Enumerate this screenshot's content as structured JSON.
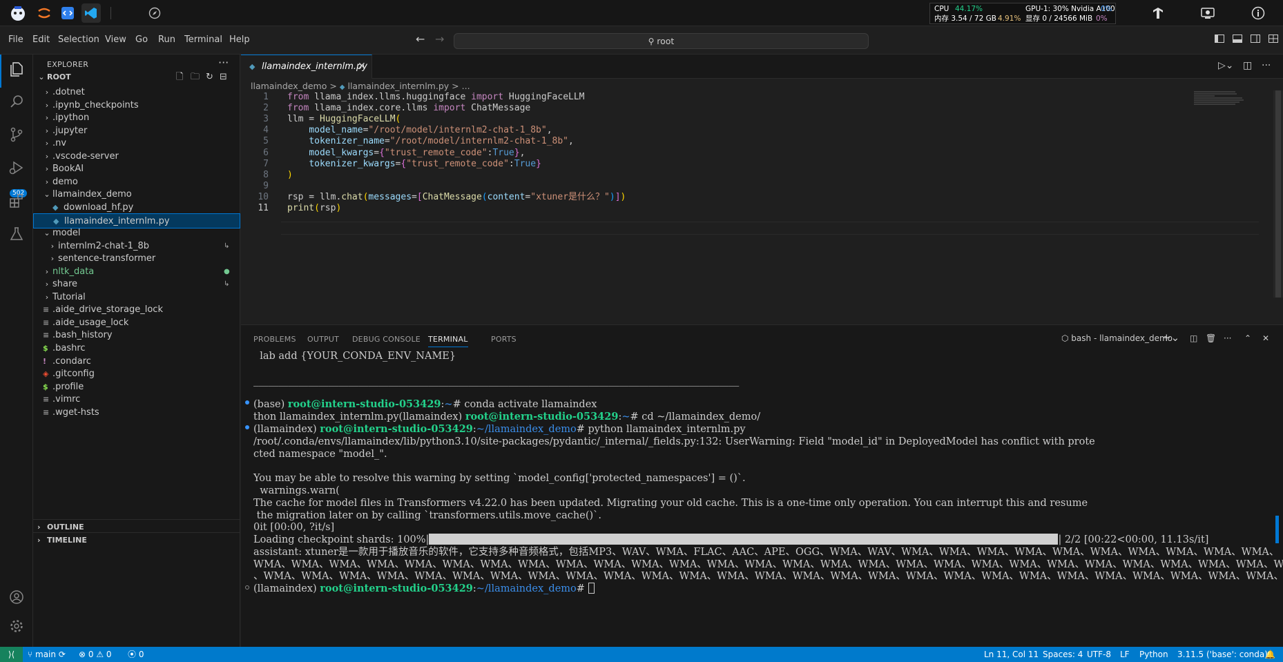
{
  "topbar": {
    "icons": [
      "mascot-icon",
      "jupyter-icon",
      "vscode-blue-icon",
      "vscode-icon",
      "compass-icon"
    ],
    "sys": {
      "cpu_label": "CPU",
      "cpu_val": "44.17%",
      "gpu_label": "GPU-1: 30% Nvidia A100",
      "gpu_val": "0%",
      "mem_label": "内存 3.54 / 72 GB",
      "mem_val": "4.91%",
      "vram_label": "显存 0 / 24566 MiB",
      "vram_val": "0%"
    },
    "right_icons": [
      "tensorboard-icon",
      "remote-desktop-icon",
      "info-icon"
    ]
  },
  "menu": {
    "items": [
      "File",
      "Edit",
      "Selection",
      "View",
      "Go",
      "Run",
      "Terminal",
      "Help"
    ],
    "search": "root"
  },
  "activity": {
    "scm_badge": "502"
  },
  "explorer": {
    "title": "EXPLORER",
    "root": "ROOT",
    "items": [
      {
        "label": ".dotnet",
        "type": "folder",
        "depth": 1,
        "state": "closed"
      },
      {
        "label": ".ipynb_checkpoints",
        "type": "folder",
        "depth": 1,
        "state": "closed"
      },
      {
        "label": ".ipython",
        "type": "folder",
        "depth": 1,
        "state": "closed"
      },
      {
        "label": ".jupyter",
        "type": "folder",
        "depth": 1,
        "state": "closed"
      },
      {
        "label": ".nv",
        "type": "folder",
        "depth": 1,
        "state": "closed"
      },
      {
        "label": ".vscode-server",
        "type": "folder",
        "depth": 1,
        "state": "closed"
      },
      {
        "label": "BookAI",
        "type": "folder",
        "depth": 1,
        "state": "closed"
      },
      {
        "label": "demo",
        "type": "folder",
        "depth": 1,
        "state": "closed"
      },
      {
        "label": "llamaindex_demo",
        "type": "folder",
        "depth": 1,
        "state": "open"
      },
      {
        "label": "download_hf.py",
        "type": "py",
        "depth": 2
      },
      {
        "label": "llamaindex_internlm.py",
        "type": "py",
        "depth": 2,
        "selected": true
      },
      {
        "label": "model",
        "type": "folder",
        "depth": 1,
        "state": "open"
      },
      {
        "label": "internlm2-chat-1_8b",
        "type": "folder",
        "depth": 2,
        "state": "closed",
        "dec": "↳"
      },
      {
        "label": "sentence-transformer",
        "type": "folder",
        "depth": 2,
        "state": "closed"
      },
      {
        "label": "nltk_data",
        "type": "folder",
        "depth": 1,
        "state": "closed",
        "color": "#73c991",
        "dec": "●"
      },
      {
        "label": "share",
        "type": "folder",
        "depth": 1,
        "state": "closed",
        "dec": "↳"
      },
      {
        "label": "Tutorial",
        "type": "folder",
        "depth": 1,
        "state": "closed"
      },
      {
        "label": ".aide_drive_storage_lock",
        "type": "lines",
        "depth": 1
      },
      {
        "label": ".aide_usage_lock",
        "type": "lines",
        "depth": 1
      },
      {
        "label": ".bash_history",
        "type": "lines",
        "depth": 1
      },
      {
        "label": ".bashrc",
        "type": "dollar",
        "depth": 1
      },
      {
        "label": ".condarc",
        "type": "excl",
        "depth": 1
      },
      {
        "label": ".gitconfig",
        "type": "git",
        "depth": 1
      },
      {
        "label": ".profile",
        "type": "dollar",
        "depth": 1
      },
      {
        "label": ".vimrc",
        "type": "lines",
        "depth": 1
      },
      {
        "label": ".wget-hsts",
        "type": "lines",
        "depth": 1
      }
    ],
    "outline": "OUTLINE",
    "timeline": "TIMELINE"
  },
  "editor": {
    "tab": "llamaindex_internlm.py",
    "breadcrumb": [
      "llamaindex_demo",
      ">",
      "llamaindex_internlm.py",
      ">",
      "..."
    ],
    "lines": [
      [
        [
          "kw",
          "from "
        ],
        [
          "nm",
          "llama_index.llms.huggingface "
        ],
        [
          "kw",
          "import "
        ],
        [
          "nm",
          "HuggingFaceLLM"
        ]
      ],
      [
        [
          "kw",
          "from "
        ],
        [
          "nm",
          "llama_index.core.llms "
        ],
        [
          "kw",
          "import "
        ],
        [
          "nm",
          "ChatMessage"
        ]
      ],
      [
        [
          "nm",
          "llm = "
        ],
        [
          "fn",
          "HuggingFaceLLM"
        ],
        [
          "br1",
          "("
        ]
      ],
      [
        [
          "nm",
          "    "
        ],
        [
          "pr",
          "model_name"
        ],
        [
          "nm",
          "="
        ],
        [
          "st",
          "\"/root/model/internlm2-chat-1_8b\""
        ],
        [
          "nm",
          ","
        ]
      ],
      [
        [
          "nm",
          "    "
        ],
        [
          "pr",
          "tokenizer_name"
        ],
        [
          "nm",
          "="
        ],
        [
          "st",
          "\"/root/model/internlm2-chat-1_8b\""
        ],
        [
          "nm",
          ","
        ]
      ],
      [
        [
          "nm",
          "    "
        ],
        [
          "pr",
          "model_kwargs"
        ],
        [
          "nm",
          "="
        ],
        [
          "br2",
          "{"
        ],
        [
          "st",
          "\"trust_remote_code\""
        ],
        [
          "nm",
          ":"
        ],
        [
          "cn",
          "True"
        ],
        [
          "br2",
          "}"
        ],
        [
          "nm",
          ","
        ]
      ],
      [
        [
          "nm",
          "    "
        ],
        [
          "pr",
          "tokenizer_kwargs"
        ],
        [
          "nm",
          "="
        ],
        [
          "br2",
          "{"
        ],
        [
          "st",
          "\"trust_remote_code\""
        ],
        [
          "nm",
          ":"
        ],
        [
          "cn",
          "True"
        ],
        [
          "br2",
          "}"
        ]
      ],
      [
        [
          "br1",
          ")"
        ]
      ],
      [
        [
          "nm",
          ""
        ]
      ],
      [
        [
          "nm",
          "rsp = llm."
        ],
        [
          "fn",
          "chat"
        ],
        [
          "br1",
          "("
        ],
        [
          "pr",
          "messages"
        ],
        [
          "nm",
          "="
        ],
        [
          "br2",
          "["
        ],
        [
          "fn",
          "ChatMessage"
        ],
        [
          "br3",
          "("
        ],
        [
          "pr",
          "content"
        ],
        [
          "nm",
          "="
        ],
        [
          "st",
          "\"xtuner是什么？\""
        ],
        [
          "br3",
          ")"
        ],
        [
          "br2",
          "]"
        ],
        [
          "br1",
          ")"
        ]
      ],
      [
        [
          "fn",
          "print"
        ],
        [
          "br1",
          "("
        ],
        [
          "nm",
          "rsp"
        ],
        [
          "br1",
          ")"
        ]
      ]
    ]
  },
  "panel": {
    "tabs": [
      "PROBLEMS",
      "OUTPUT",
      "DEBUG CONSOLE",
      "TERMINAL",
      "PORTS"
    ],
    "active": "TERMINAL",
    "term_name": "bash - llamaindex_demo",
    "term": {
      "l1": "  lab add {YOUR_CONDA_ENV_NAME}",
      "l2": "_________________________________________________________________________________________________",
      "l3a": "(base) ",
      "l3b": "root@intern-studio-053429",
      "l3c": ":",
      "l3d": "~",
      "l3e": "# conda activate llamaindex",
      "l4a": "thon llamaindex_internlm.py(llamaindex) ",
      "l4b": "root@intern-studio-053429",
      "l4c": ":",
      "l4d": "~",
      "l4e": "# cd ~/llamaindex_demo/",
      "l5a": "(llamaindex) ",
      "l5b": "root@intern-studio-053429",
      "l5c": ":",
      "l5d": "~/llamaindex_demo",
      "l5e": "# python llamaindex_internlm.py",
      "l6": "/root/.conda/envs/llamaindex/lib/python3.10/site-packages/pydantic/_internal/_fields.py:132: UserWarning: Field \"model_id\" in DeployedModel has conflict with prote",
      "l7": "cted namespace \"model_\".",
      "l8": "",
      "l9": "You may be able to resolve this warning by setting `model_config['protected_namespaces'] = ()`.",
      "l10": "  warnings.warn(",
      "l11": "The cache for model files in Transformers v4.22.0 has been updated. Migrating your old cache. This is a one-time only operation. You can interrupt this and resume",
      "l12": " the migration later on by calling `transformers.utils.move_cache()`.",
      "l13": "0it [00:00, ?it/s]",
      "l14a": "Loading checkpoint shards: 100%|",
      "l14b": "| 2/2 [00:22<00:00, 11.13s/it]",
      "l15": "assistant: xtuner是一款用于播放音乐的软件，它支持多种音频格式，包括MP3、WAV、WMA、FLAC、AAC、APE、OGG、WMA、WAV、WMA、WMA、WMA、WMA、WMA、WMA、WMA、WMA、WMA、WMA、",
      "l16": "WMA、WMA、WMA、WMA、WMA、WMA、WMA、WMA、WMA、WMA、WMA、WMA、WMA、WMA、WMA、WMA、WMA、WMA、WMA、WMA、WMA、WMA、WMA、WMA、WMA、WMA、WMA、WMA、WMA、WMA",
      "l17": "、WMA、WMA、WMA、WMA、WMA、WMA、WMA、WMA、WMA、WMA、WMA、WMA、WMA、WMA、WMA、WMA、WMA、WMA、WMA、WMA、WMA、WMA、WMA、WMA、WMA、WMA、WMA、W",
      "l18a": "(llamaindex) ",
      "l18b": "root@intern-studio-053429",
      "l18c": ":",
      "l18d": "~/llamaindex_demo",
      "l18e": "# "
    }
  },
  "status": {
    "branch": "main",
    "errors": "0",
    "warnings": "0",
    "ports": "0",
    "position": "Ln 11, Col 11",
    "spaces": "Spaces: 4",
    "encoding": "UTF-8",
    "eol": "LF",
    "lang": "Python",
    "interp": "3.11.5 ('base': conda)"
  }
}
